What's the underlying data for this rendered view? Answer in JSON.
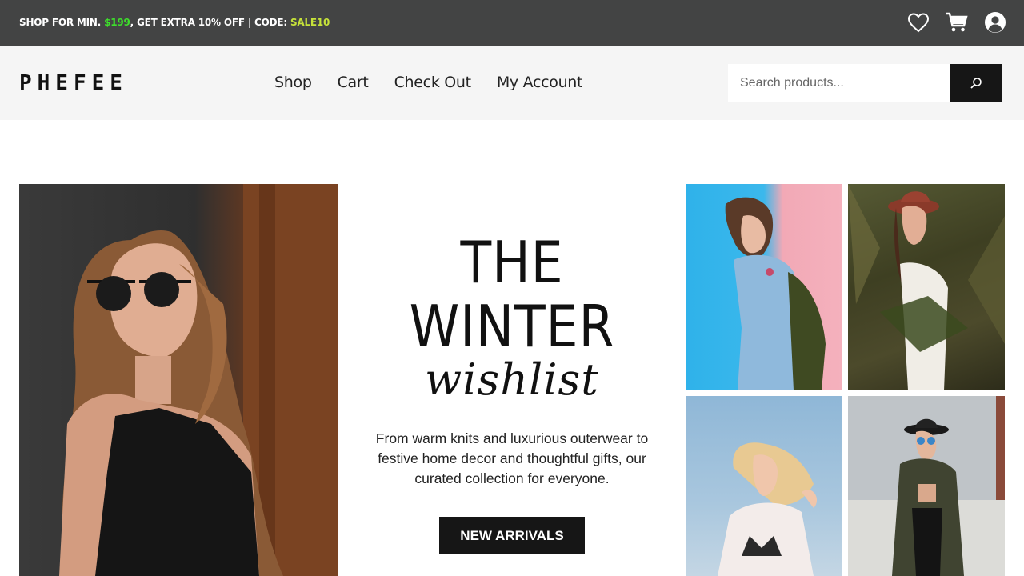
{
  "promo": {
    "part1": "SHOP FOR MIN. ",
    "amount": "$199",
    "part2": ", GET EXTRA 10% OFF | CODE: ",
    "code": "SALE10",
    "colors": {
      "amount": "#3ee02b",
      "code": "#c6e23a",
      "background": "#434444"
    }
  },
  "top_icons": [
    "heart-icon",
    "cart-icon",
    "account-icon"
  ],
  "header": {
    "logo": "PHEFEE",
    "nav": [
      "Shop",
      "Cart",
      "Check Out",
      "My Account"
    ],
    "search_placeholder": "Search products...",
    "search_icon": "search-icon"
  },
  "hero": {
    "title_line1": "THE",
    "title_line2": "WINTER",
    "title_line3": "wishlist",
    "description": "From warm knits and luxurious outerwear to festive home decor and thoughtful gifts, our curated collection for everyone.",
    "cta_label": "NEW ARRIVALS"
  },
  "images": {
    "main": "woman-sunglasses-photo",
    "grid": [
      "woman-denim-jacket-photo",
      "woman-hat-foliage-photo",
      "woman-blonde-blouse-photo",
      "woman-hat-coat-photo"
    ]
  }
}
